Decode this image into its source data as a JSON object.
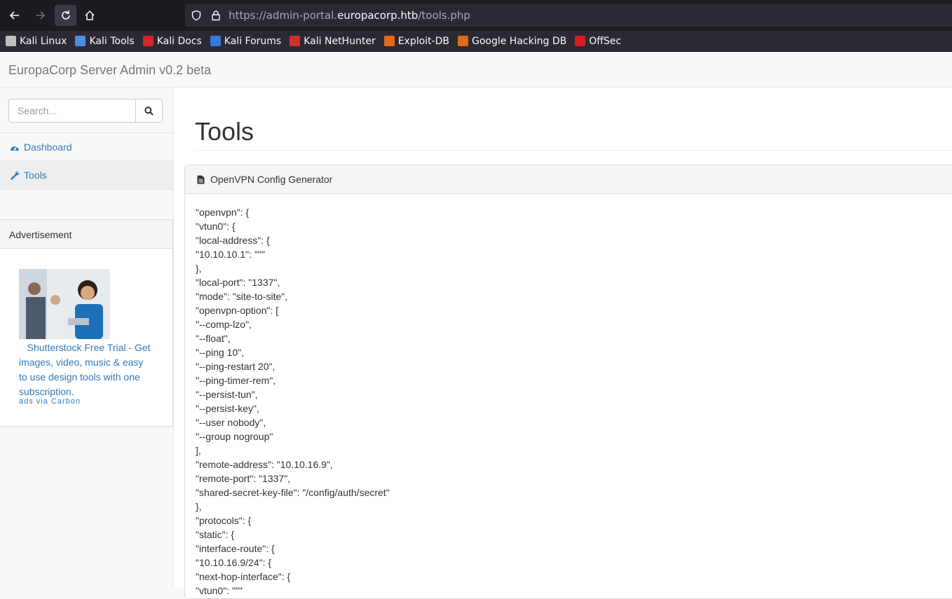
{
  "browser": {
    "url_prefix": "https://admin-portal.",
    "url_host": "europacorp.htb",
    "url_path": "/tools.php"
  },
  "bookmarks": [
    {
      "label": "Kali Linux",
      "icon": "kali-dragon-icon",
      "color": "#bfbfbf"
    },
    {
      "label": "Kali Tools",
      "icon": "kali-tools-icon",
      "color": "#4a8fe2"
    },
    {
      "label": "Kali Docs",
      "icon": "kali-docs-icon",
      "color": "#d02828"
    },
    {
      "label": "Kali Forums",
      "icon": "kali-forums-icon",
      "color": "#3a78d8"
    },
    {
      "label": "Kali NetHunter",
      "icon": "kali-nethunter-icon",
      "color": "#d23030"
    },
    {
      "label": "Exploit-DB",
      "icon": "exploit-db-icon",
      "color": "#e06a1c"
    },
    {
      "label": "Google Hacking DB",
      "icon": "ghdb-icon",
      "color": "#e06a1c"
    },
    {
      "label": "OffSec",
      "icon": "offsec-icon",
      "color": "#d41e1e"
    }
  ],
  "navbar": {
    "brand": "EuropaCorp Server Admin v0.2 beta"
  },
  "sidebar": {
    "search_placeholder": "Search...",
    "items": [
      {
        "label": "Dashboard",
        "icon": "dashboard-icon"
      },
      {
        "label": "Tools",
        "icon": "wrench-icon"
      }
    ],
    "ad": {
      "heading": "Advertisement",
      "text": "Shutterstock Free Trial - Get images, video, music & easy to use design tools with one subscription.",
      "via": "ads via Carbon"
    }
  },
  "main": {
    "title": "Tools",
    "panel_heading": "OpenVPN Config Generator",
    "config_lines": [
      "\"openvpn\": {",
      "\"vtun0\": {",
      "\"local-address\": {",
      "\"10.10.10.1\": \"\"\"",
      "},",
      "\"local-port\": \"1337\",",
      "\"mode\": \"site-to-site\",",
      "\"openvpn-option\": [",
      "\"--comp-lzo\",",
      "\"--float\",",
      "\"--ping 10\",",
      "\"--ping-restart 20\",",
      "\"--ping-timer-rem\",",
      "\"--persist-tun\",",
      "\"--persist-key\",",
      "\"--user nobody\",",
      "\"--group nogroup\"",
      "],",
      "\"remote-address\": \"10.10.16.9\",",
      "\"remote-port\": \"1337\",",
      "\"shared-secret-key-file\": \"/config/auth/secret\"",
      "},",
      "\"protocols\": {",
      "\"static\": {",
      "\"interface-route\": {",
      "\"10.10.16.9/24\": {",
      "\"next-hop-interface\": {",
      "\"vtun0\": \"\"\""
    ]
  }
}
